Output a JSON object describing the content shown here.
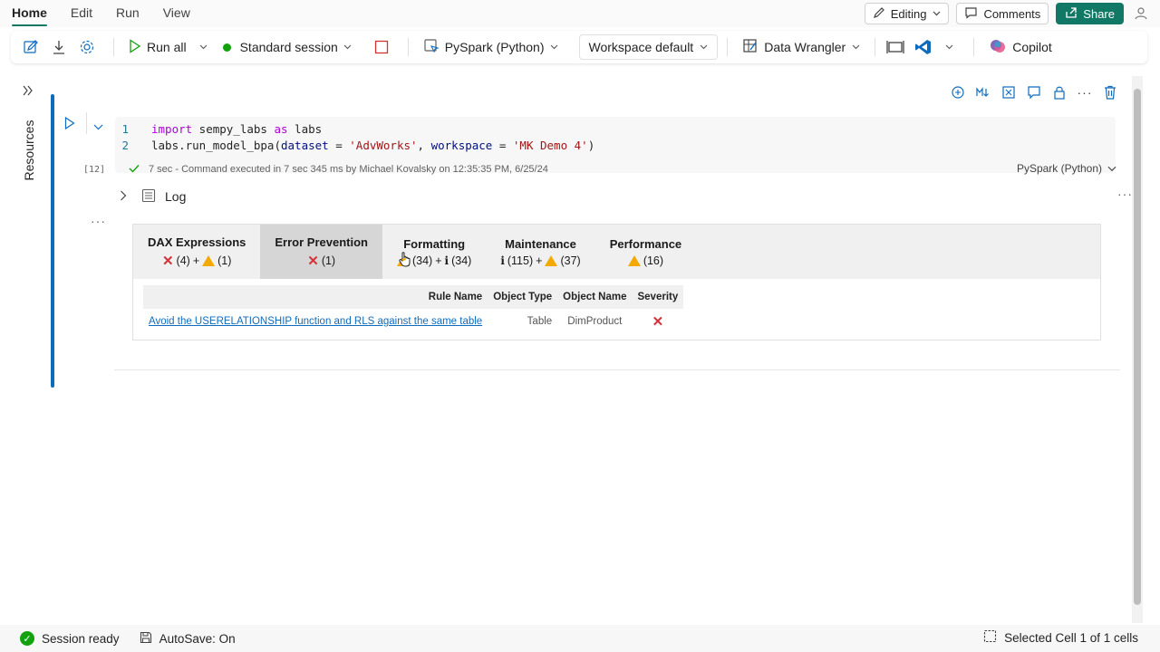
{
  "menu": {
    "items": [
      "Home",
      "Edit",
      "Run",
      "View"
    ],
    "active": "Home"
  },
  "topright": {
    "editing_label": "Editing",
    "comments_label": "Comments",
    "share_label": "Share"
  },
  "toolbar": {
    "run_all_label": "Run all",
    "session_label": "Standard session",
    "language_label": "PySpark (Python)",
    "workspace_label": "Workspace default",
    "data_wrangler_label": "Data Wrangler",
    "copilot_label": "Copilot"
  },
  "rail": {
    "label": "Resources"
  },
  "cell": {
    "code": [
      {
        "num": "1",
        "tokens": [
          {
            "t": "import",
            "c": "kw"
          },
          {
            "t": " sempy_labs ",
            "c": ""
          },
          {
            "t": "as",
            "c": "kw"
          },
          {
            "t": " labs",
            "c": ""
          }
        ]
      },
      {
        "num": "2",
        "tokens": [
          {
            "t": "labs.run_model_bpa(",
            "c": ""
          },
          {
            "t": "dataset",
            "c": "param"
          },
          {
            "t": " = ",
            "c": ""
          },
          {
            "t": "'AdvWorks'",
            "c": "str"
          },
          {
            "t": ", ",
            "c": ""
          },
          {
            "t": "workspace",
            "c": "param"
          },
          {
            "t": " = ",
            "c": ""
          },
          {
            "t": "'MK Demo 4'",
            "c": "str"
          },
          {
            "t": ")",
            "c": ""
          }
        ]
      }
    ],
    "exec_count": "[12]",
    "exec_status": "7 sec - Command executed in 7 sec 345 ms by Michael Kovalsky on 12:35:35 PM, 6/25/24",
    "language": "PySpark (Python)"
  },
  "log_label": "Log",
  "bpa": {
    "tabs": [
      {
        "title": "DAX Expressions",
        "counts": [
          {
            "icon": "x",
            "n": "(4)"
          },
          {
            "sep": "+"
          },
          {
            "icon": "warn",
            "n": "(1)"
          }
        ],
        "selected": false
      },
      {
        "title": "Error Prevention",
        "counts": [
          {
            "icon": "x",
            "n": "(1)"
          }
        ],
        "selected": true
      },
      {
        "title": "Formatting",
        "counts": [
          {
            "icon": "warn",
            "n": "(34)"
          },
          {
            "sep": "+"
          },
          {
            "icon": "info",
            "n": "(34)"
          }
        ],
        "selected": false
      },
      {
        "title": "Maintenance",
        "counts": [
          {
            "icon": "info",
            "n": "(115)"
          },
          {
            "sep": "+"
          },
          {
            "icon": "warn",
            "n": "(37)"
          }
        ],
        "selected": false
      },
      {
        "title": "Performance",
        "counts": [
          {
            "icon": "warn",
            "n": "(16)"
          }
        ],
        "selected": false
      }
    ],
    "columns": [
      "Rule Name",
      "Object Type",
      "Object Name",
      "Severity"
    ],
    "rows": [
      {
        "rule": "Avoid the USERELATIONSHIP function and RLS against the same table",
        "type": "Table",
        "name": "DimProduct",
        "severity": "x"
      }
    ]
  },
  "status": {
    "session": "Session ready",
    "autosave": "AutoSave: On",
    "selection": "Selected Cell 1 of 1 cells"
  },
  "colors": {
    "accent": "#117865",
    "cell_bar": "#0f6cbd",
    "error": "#d13438",
    "warning": "#f2a900"
  }
}
